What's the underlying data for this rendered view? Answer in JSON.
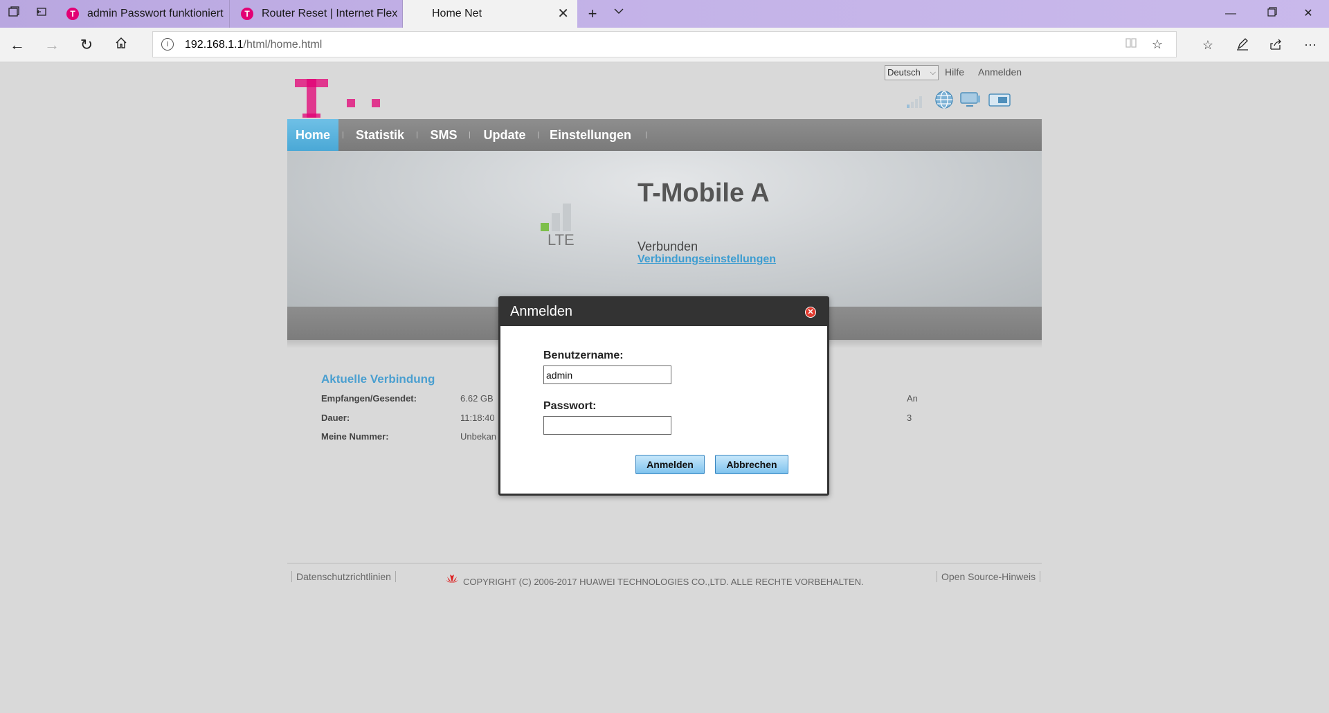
{
  "browser": {
    "tabs": [
      {
        "title": "admin Passwort funktioniert"
      },
      {
        "title": "Router Reset | Internet Flex"
      },
      {
        "title": "Home Net"
      }
    ],
    "url_host": "192.168.1.1",
    "url_path": "/html/home.html"
  },
  "router": {
    "language": "Deutsch",
    "help_link": "Hilfe",
    "login_link": "Anmelden",
    "nav": [
      "Home",
      "Statistik",
      "SMS",
      "Update",
      "Einstellungen"
    ],
    "network_name": "T-Mobile A",
    "network_type": "LTE",
    "signal_bars_active": 1,
    "signal_bars_total": 3,
    "connection_status": "Verbunden",
    "connection_settings_link": "Verbindungseinstellungen",
    "current_connection": {
      "title": "Aktuelle Verbindung",
      "rows": [
        {
          "label": "Empfangen/Gesendet:",
          "value": "6.62 GB",
          "right": "An"
        },
        {
          "label": "Dauer:",
          "value": "11:18:40",
          "right": "3"
        },
        {
          "label": "Meine Nummer:",
          "value": "Unbekan",
          "right": ""
        }
      ]
    },
    "footer": {
      "privacy": "Datenschutzrichtlinien",
      "copyright": "COPYRIGHT (C) 2006-2017 HUAWEI TECHNOLOGIES CO.,LTD. ALLE RECHTE VORBEHALTEN.",
      "open_source": "Open Source-Hinweis"
    }
  },
  "dialog": {
    "title": "Anmelden",
    "username_label": "Benutzername:",
    "username_value": "admin",
    "password_label": "Passwort:",
    "password_value": "",
    "login_button": "Anmelden",
    "cancel_button": "Abbrechen"
  },
  "colors": {
    "telekom_magenta": "#e20074",
    "nav_active": "#4aa8d6",
    "link_blue": "#3d9dd1"
  }
}
